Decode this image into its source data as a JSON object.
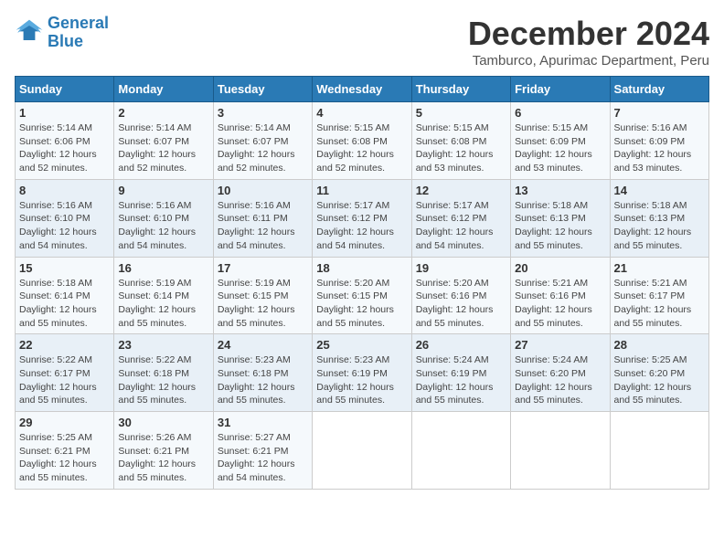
{
  "logo": {
    "line1": "General",
    "line2": "Blue"
  },
  "title": "December 2024",
  "subtitle": "Tamburco, Apurimac Department, Peru",
  "weekdays": [
    "Sunday",
    "Monday",
    "Tuesday",
    "Wednesday",
    "Thursday",
    "Friday",
    "Saturday"
  ],
  "weeks": [
    [
      {
        "day": "1",
        "info": "Sunrise: 5:14 AM\nSunset: 6:06 PM\nDaylight: 12 hours and 52 minutes."
      },
      {
        "day": "2",
        "info": "Sunrise: 5:14 AM\nSunset: 6:07 PM\nDaylight: 12 hours and 52 minutes."
      },
      {
        "day": "3",
        "info": "Sunrise: 5:14 AM\nSunset: 6:07 PM\nDaylight: 12 hours and 52 minutes."
      },
      {
        "day": "4",
        "info": "Sunrise: 5:15 AM\nSunset: 6:08 PM\nDaylight: 12 hours and 52 minutes."
      },
      {
        "day": "5",
        "info": "Sunrise: 5:15 AM\nSunset: 6:08 PM\nDaylight: 12 hours and 53 minutes."
      },
      {
        "day": "6",
        "info": "Sunrise: 5:15 AM\nSunset: 6:09 PM\nDaylight: 12 hours and 53 minutes."
      },
      {
        "day": "7",
        "info": "Sunrise: 5:16 AM\nSunset: 6:09 PM\nDaylight: 12 hours and 53 minutes."
      }
    ],
    [
      {
        "day": "8",
        "info": "Sunrise: 5:16 AM\nSunset: 6:10 PM\nDaylight: 12 hours and 54 minutes."
      },
      {
        "day": "9",
        "info": "Sunrise: 5:16 AM\nSunset: 6:10 PM\nDaylight: 12 hours and 54 minutes."
      },
      {
        "day": "10",
        "info": "Sunrise: 5:16 AM\nSunset: 6:11 PM\nDaylight: 12 hours and 54 minutes."
      },
      {
        "day": "11",
        "info": "Sunrise: 5:17 AM\nSunset: 6:12 PM\nDaylight: 12 hours and 54 minutes."
      },
      {
        "day": "12",
        "info": "Sunrise: 5:17 AM\nSunset: 6:12 PM\nDaylight: 12 hours and 54 minutes."
      },
      {
        "day": "13",
        "info": "Sunrise: 5:18 AM\nSunset: 6:13 PM\nDaylight: 12 hours and 55 minutes."
      },
      {
        "day": "14",
        "info": "Sunrise: 5:18 AM\nSunset: 6:13 PM\nDaylight: 12 hours and 55 minutes."
      }
    ],
    [
      {
        "day": "15",
        "info": "Sunrise: 5:18 AM\nSunset: 6:14 PM\nDaylight: 12 hours and 55 minutes."
      },
      {
        "day": "16",
        "info": "Sunrise: 5:19 AM\nSunset: 6:14 PM\nDaylight: 12 hours and 55 minutes."
      },
      {
        "day": "17",
        "info": "Sunrise: 5:19 AM\nSunset: 6:15 PM\nDaylight: 12 hours and 55 minutes."
      },
      {
        "day": "18",
        "info": "Sunrise: 5:20 AM\nSunset: 6:15 PM\nDaylight: 12 hours and 55 minutes."
      },
      {
        "day": "19",
        "info": "Sunrise: 5:20 AM\nSunset: 6:16 PM\nDaylight: 12 hours and 55 minutes."
      },
      {
        "day": "20",
        "info": "Sunrise: 5:21 AM\nSunset: 6:16 PM\nDaylight: 12 hours and 55 minutes."
      },
      {
        "day": "21",
        "info": "Sunrise: 5:21 AM\nSunset: 6:17 PM\nDaylight: 12 hours and 55 minutes."
      }
    ],
    [
      {
        "day": "22",
        "info": "Sunrise: 5:22 AM\nSunset: 6:17 PM\nDaylight: 12 hours and 55 minutes."
      },
      {
        "day": "23",
        "info": "Sunrise: 5:22 AM\nSunset: 6:18 PM\nDaylight: 12 hours and 55 minutes."
      },
      {
        "day": "24",
        "info": "Sunrise: 5:23 AM\nSunset: 6:18 PM\nDaylight: 12 hours and 55 minutes."
      },
      {
        "day": "25",
        "info": "Sunrise: 5:23 AM\nSunset: 6:19 PM\nDaylight: 12 hours and 55 minutes."
      },
      {
        "day": "26",
        "info": "Sunrise: 5:24 AM\nSunset: 6:19 PM\nDaylight: 12 hours and 55 minutes."
      },
      {
        "day": "27",
        "info": "Sunrise: 5:24 AM\nSunset: 6:20 PM\nDaylight: 12 hours and 55 minutes."
      },
      {
        "day": "28",
        "info": "Sunrise: 5:25 AM\nSunset: 6:20 PM\nDaylight: 12 hours and 55 minutes."
      }
    ],
    [
      {
        "day": "29",
        "info": "Sunrise: 5:25 AM\nSunset: 6:21 PM\nDaylight: 12 hours and 55 minutes."
      },
      {
        "day": "30",
        "info": "Sunrise: 5:26 AM\nSunset: 6:21 PM\nDaylight: 12 hours and 55 minutes."
      },
      {
        "day": "31",
        "info": "Sunrise: 5:27 AM\nSunset: 6:21 PM\nDaylight: 12 hours and 54 minutes."
      },
      null,
      null,
      null,
      null
    ]
  ]
}
